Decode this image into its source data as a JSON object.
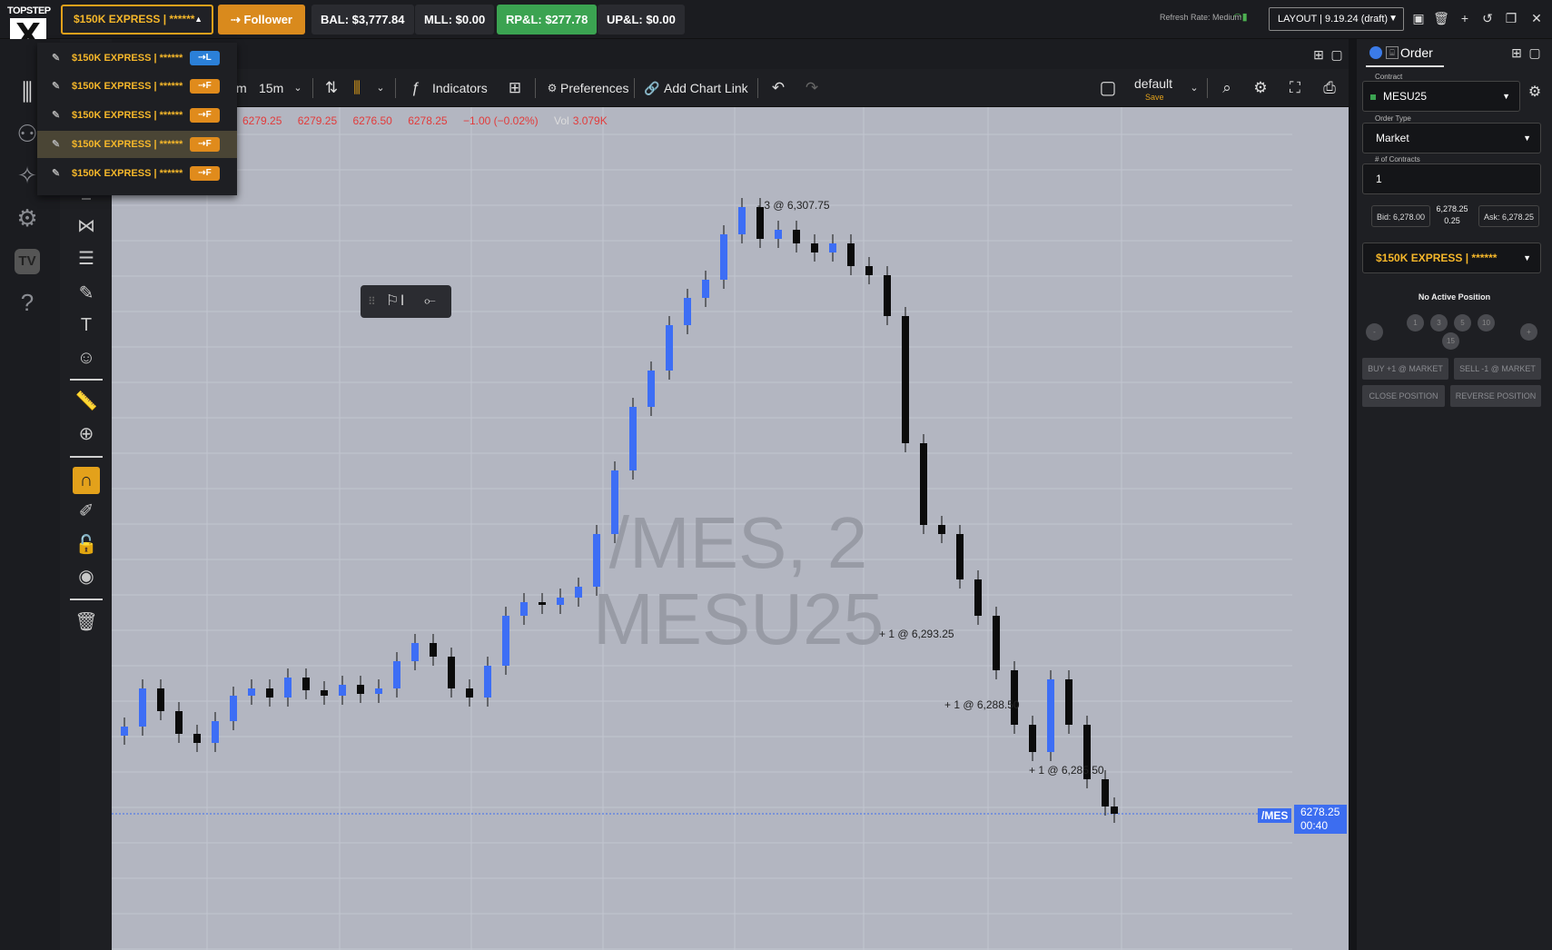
{
  "topbar": {
    "logo_text": "TOPSTEP",
    "logo_mark": "X",
    "account_selector": "$150K EXPRESS | ******",
    "follower_label": "Follower",
    "stats": [
      {
        "label": "BAL: $3,777.84",
        "color": "#2a2b30"
      },
      {
        "label": "MLL: $0.00",
        "color": "#2a2b30"
      },
      {
        "label": "RP&L: $277.78",
        "color": "#3ba351"
      },
      {
        "label": "UP&L: $0.00",
        "color": "#2a2b30"
      }
    ],
    "refresh_rate": "Refresh Rate: Medium",
    "layout_selector": "LAYOUT | 9.19.24 (draft)",
    "icons": [
      "save-icon",
      "trash-icon",
      "plus-icon",
      "undo-icon",
      "restore-window-icon",
      "close-icon"
    ]
  },
  "account_dropdown": {
    "items": [
      {
        "label": "$150K EXPRESS | ******",
        "badge": "⇢L",
        "badge_type": "leader"
      },
      {
        "label": "$150K EXPRESS | ******",
        "badge": "⇢F",
        "badge_type": "follower"
      },
      {
        "label": "$150K EXPRESS | ******",
        "badge": "⇢F",
        "badge_type": "follower"
      },
      {
        "label": "$150K EXPRESS | ******",
        "badge": "⇢F",
        "badge_type": "follower"
      },
      {
        "label": "$150K EXPRESS | ******",
        "badge": "⇢F",
        "badge_type": "follower"
      }
    ]
  },
  "left_nav": {
    "tv_label": "TV",
    "icons": [
      "chart-icon",
      "community-icon",
      "magic-icon",
      "settings-icon",
      "tv-icon",
      "help-icon"
    ]
  },
  "chart_toolbar": {
    "interval_partial": "m",
    "interval": "15m",
    "indicators_label": "Indicators",
    "preferences_label": "Preferences",
    "add_chart_link_label": "Add Chart Link",
    "template_label": "default",
    "template_save": "Save"
  },
  "chart": {
    "ohlc": {
      "open": "6279.25",
      "high": "6279.25",
      "low": "6276.50",
      "close": "6278.25",
      "change": "−1.00 (−0.02%)",
      "vol_label": "Vol",
      "vol": "3.079K"
    },
    "watermark_line1": "/MES, 2",
    "watermark_line2": "MESU25",
    "trade_labels": [
      "- 3 @ 6,307.75",
      "+ 1 @ 6,293.25",
      "+ 1 @ 6,288.50",
      "+ 1 @ 6,285.50"
    ],
    "last_symbol": "/MES",
    "last_price": "6278.25",
    "countdown": "00:40",
    "colors": {
      "up": "#3d6ef5",
      "down": "#0b0b0b",
      "background": "#b3b6c1"
    }
  },
  "order_panel": {
    "tab_label": "Order",
    "contract_label": "Contract",
    "contract_value": "MESU25",
    "order_type_label": "Order Type",
    "order_type_value": "Market",
    "contracts_label": "# of Contracts",
    "contracts_value": "1",
    "bid": "Bid: 6,278.00",
    "last": "6,278.25",
    "spread": "0.25",
    "ask": "Ask: 6,278.25",
    "account": "$150K EXPRESS | ******",
    "position_status": "No Active Position",
    "minus": "-",
    "plus": "+",
    "quick_qty": [
      "1",
      "3",
      "5",
      "10",
      "15"
    ],
    "buttons": {
      "buy": "BUY +1 @ MARKET",
      "sell": "SELL -1 @ MARKET",
      "close": "CLOSE POSITION",
      "reverse": "REVERSE POSITION"
    }
  }
}
